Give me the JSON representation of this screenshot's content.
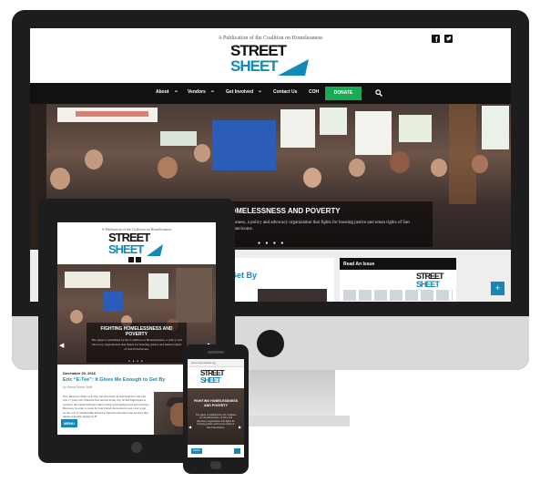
{
  "desktop": {
    "publication_line": "A Publication of the Coalition on Homelessness",
    "logo_top": "STREET",
    "logo_bottom": "SHEET",
    "nav": [
      "About",
      "Vendors",
      "Get Involved",
      "Contact Us",
      "COH"
    ],
    "donate": "DONATE",
    "hero_title": "OMELESSNESS AND POVERTY",
    "hero_text": "lessness, a policy and advocacy organization that fights for housing justice and uman rights of San Franciscans.",
    "card_title": "Get By",
    "issue_heading": "Read An Issue",
    "plus": "+"
  },
  "tablet": {
    "publication_line": "A Publication of the Coalition on Homelessness",
    "logo_top": "STREET",
    "logo_bottom": "SHEET",
    "hero_title": "FIGHTING HOMELESSNESS AND POVERTY",
    "hero_text": "The paper is published by the Coalition on Homelessness, a policy and advocacy organization that fights for housing justice and human rights of San Franciscans.",
    "post_date": "December 20, 2016",
    "post_title": "Eric “E-Tee”: It Gives Me Enough to Get By",
    "post_author": "by Street Sheet Staff",
    "post_excerpt": "Eric, known to many as E-Tee, has lived here in San Francisco since he was 17 years old. When he first arrived in the city, he had high hopes to work for the General Motors Union doing work laying brick and concrete. However, in order to work for four Union, he needed to pay a fee to get in: the cost of membership needed to fund the education and services that unions typically engage in. H",
    "menu": "MENU"
  },
  "phone": {
    "url": "www.streetsheet.org",
    "logo_top": "STREET",
    "logo_bottom": "SHEET",
    "hero_title": "FIGHTING HOMELESSNESS AND POVERTY",
    "hero_text": "The paper is published by the Coalition on Homelessness, a policy and advocacy organization that fights for housing justice and human rights of San Franciscans.",
    "menu": "MENU"
  },
  "colors": {
    "accent": "#1289b8",
    "donate": "#1aaa55",
    "nav_bg": "#111111",
    "device": "#1d1d1f"
  }
}
